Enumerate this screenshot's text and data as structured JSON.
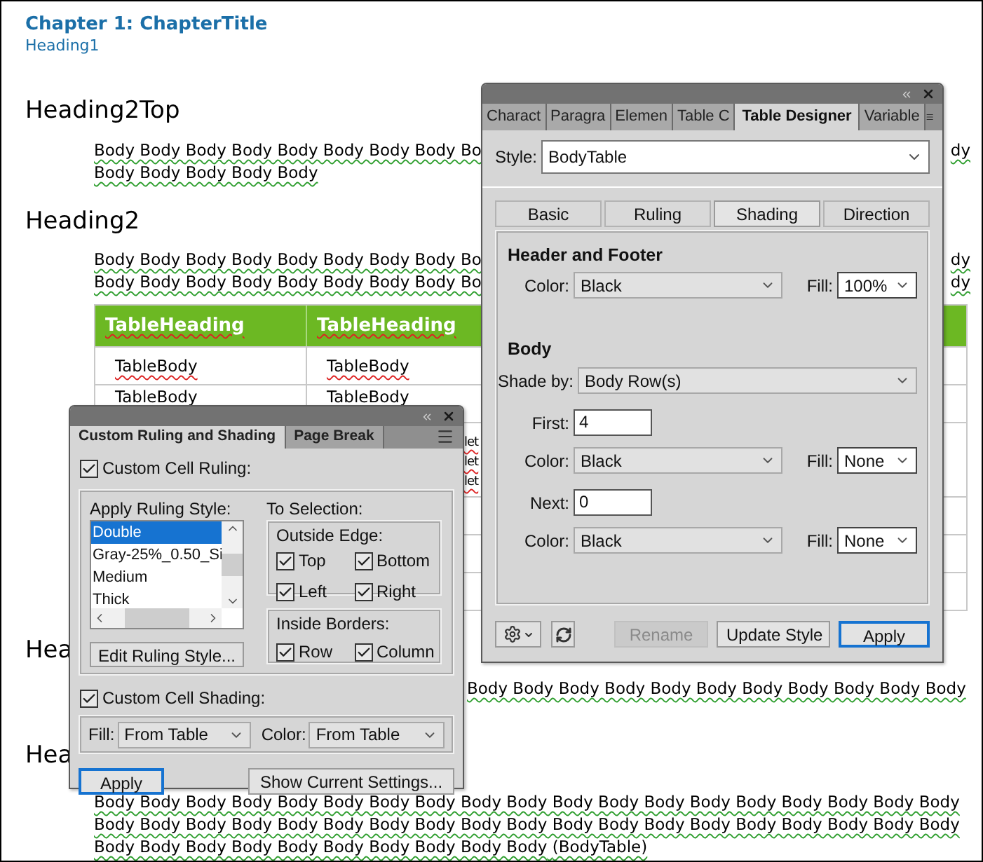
{
  "document": {
    "chapter_title": "Chapter 1: ChapterTitle",
    "heading1": "Heading1",
    "sections": [
      {
        "heading": "Heading2Top",
        "lines": [
          {
            "kind": "full",
            "text": "Body Body Body Body Body Body Body Body Bo",
            "tail": "dy"
          },
          {
            "kind": "full",
            "text": "Body Body Body Body Body"
          }
        ]
      },
      {
        "heading": "Heading2",
        "lines": [
          {
            "kind": "full",
            "text": "Body Body Body Body Body Body Body Body Bo",
            "tail": "dy"
          },
          {
            "kind": "full",
            "text": "Body Body Body Body Body Body Body Body Bo",
            "tail": "dy"
          }
        ],
        "table": {
          "columns": [
            "TableHeading",
            "TableHeading"
          ],
          "rows": [
            {
              "cells": [
                "TableBody",
                "TableBody"
              ]
            },
            {
              "cells": [
                "TableBody",
                "TableBody"
              ]
            },
            {
              "column_2_lines": [
                "let",
                "let",
                "let"
              ]
            }
          ]
        }
      },
      {
        "heading": "Hea",
        "lines": [
          {
            "kind": "right",
            "text": "Body Body Body Body Body Body Body Body Body Body Body"
          }
        ]
      },
      {
        "heading": "Hea",
        "lines": [
          {
            "kind": "full",
            "text": "Body Body Body Body Body Body Body Body Body Body Body Body Body Body Body Body Body Body Body"
          },
          {
            "kind": "full",
            "text": "Body Body Body Body Body Body Body Body Body Body Body Body Body Body Body Body Body Body Body"
          },
          {
            "kind": "full",
            "text": "Body Body Body Body Body Body Body Body Body Body",
            "tag": "(BodyTable)"
          }
        ]
      }
    ]
  },
  "table_designer": {
    "tabs": [
      {
        "label": "Charact",
        "selected": false
      },
      {
        "label": "Paragra",
        "selected": false
      },
      {
        "label": "Elemen",
        "selected": false
      },
      {
        "label": "Table C",
        "selected": false
      },
      {
        "label": "Table Designer",
        "selected": true
      },
      {
        "label": "Variable",
        "selected": false
      }
    ],
    "style": {
      "label": "Style:",
      "value": "BodyTable"
    },
    "subtabs": [
      {
        "label": "Basic",
        "selected": false
      },
      {
        "label": "Ruling",
        "selected": false
      },
      {
        "label": "Shading",
        "selected": true
      },
      {
        "label": "Direction",
        "selected": false
      }
    ],
    "header_footer": {
      "title": "Header and Footer",
      "color": {
        "label": "Color:",
        "value": "Black"
      },
      "fill": {
        "label": "Fill:",
        "value": "100%"
      }
    },
    "body": {
      "title": "Body",
      "shade_by": {
        "label": "Shade by:",
        "value": "Body Row(s)"
      },
      "groups": [
        {
          "count": {
            "label": "First:",
            "value": "4"
          },
          "color": {
            "label": "Color:",
            "value": "Black"
          },
          "fill": {
            "label": "Fill:",
            "value": "None"
          }
        },
        {
          "count": {
            "label": "Next:",
            "value": "0"
          },
          "color": {
            "label": "Color:",
            "value": "Black"
          },
          "fill": {
            "label": "Fill:",
            "value": "None"
          }
        }
      ]
    },
    "buttons": [
      {
        "label": "Rename",
        "disabled": true,
        "default": false
      },
      {
        "label": "Update Style",
        "disabled": false,
        "default": false
      },
      {
        "label": "Apply",
        "disabled": false,
        "default": true
      }
    ]
  },
  "ruling_panel": {
    "tabs": [
      {
        "label": "Custom Ruling and Shading",
        "selected": true
      },
      {
        "label": "Page Break",
        "selected": false
      }
    ],
    "custom_cell_ruling": {
      "label": "Custom Cell Ruling:",
      "checked": true
    },
    "apply_ruling_style": {
      "label": "Apply Ruling Style:",
      "items": [
        {
          "label": "Double",
          "selected": true
        },
        {
          "label": "Gray-25%_0.50_Si",
          "selected": false
        },
        {
          "label": "Medium",
          "selected": false
        },
        {
          "label": "Thick",
          "selected": false
        }
      ]
    },
    "to_selection": "To Selection:",
    "outside_edge": {
      "label": "Outside Edge:",
      "options": [
        {
          "label": "Top",
          "checked": true
        },
        {
          "label": "Bottom",
          "checked": true
        },
        {
          "label": "Left",
          "checked": true
        },
        {
          "label": "Right",
          "checked": true
        }
      ]
    },
    "edit_button": "Edit Ruling Style...",
    "inside_borders": {
      "label": "Inside Borders:",
      "options": [
        {
          "label": "Row",
          "checked": true
        },
        {
          "label": "Column",
          "checked": true
        }
      ]
    },
    "custom_cell_shading": {
      "label": "Custom Cell Shading:",
      "checked": true
    },
    "fill": {
      "label": "Fill:",
      "value": "From Table"
    },
    "color": {
      "label": "Color:",
      "value": "From Table"
    },
    "buttons": [
      {
        "label": "Apply",
        "default": true
      },
      {
        "label": "Show Current Settings...",
        "default": false
      }
    ]
  }
}
